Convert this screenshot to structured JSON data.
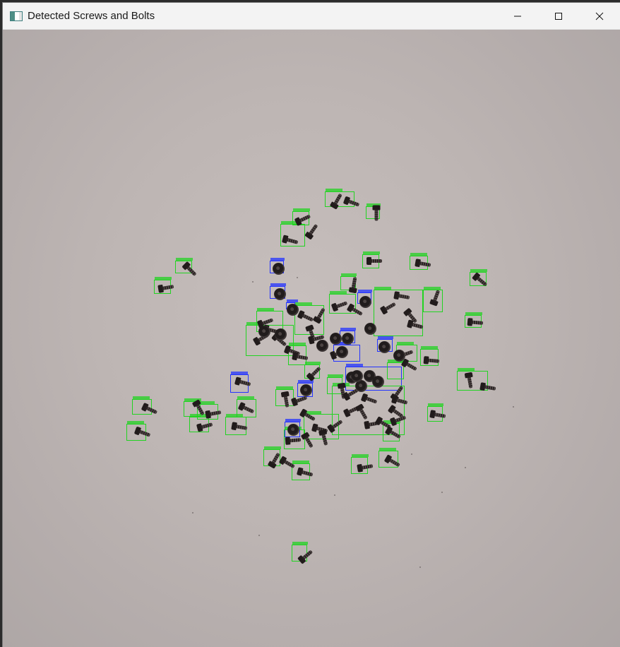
{
  "window": {
    "title": "Detected Screws and Bolts",
    "controls": {
      "minimize": "minimize-icon",
      "maximize": "maximize-icon",
      "close": "close-icon"
    }
  },
  "image": {
    "background_color": "#b8b0ae",
    "detection_colors": {
      "green": "#22d322",
      "blue": "#2333ff"
    }
  }
}
